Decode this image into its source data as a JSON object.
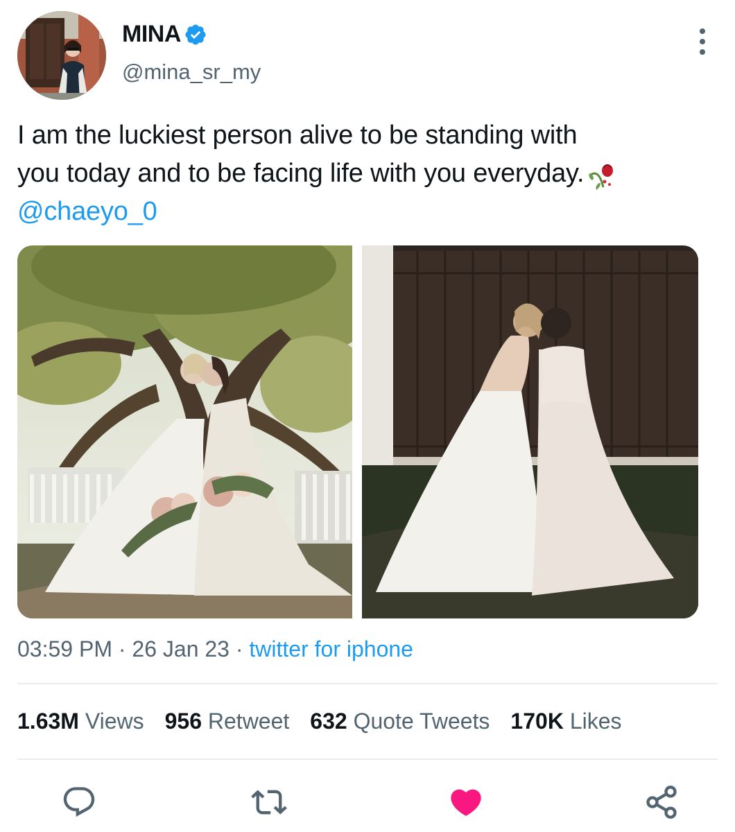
{
  "user": {
    "name": "MINA",
    "handle": "@mina_sr_my",
    "verified": true,
    "avatar_icon": "profile-photo"
  },
  "tweet": {
    "text_line1": "I am the luckiest person alive to be standing with",
    "text_line2": "you today and to be facing life with you everyday.",
    "emoji_icon": "wilted-rose-emoji",
    "mention": "@chaeyo_0",
    "photos": [
      "wedding-photo-under-tree",
      "wedding-photo-barn-door"
    ]
  },
  "meta": {
    "time": "03:59 PM",
    "separator": " · ",
    "date": "26 Jan 23",
    "source": "twitter for iphone"
  },
  "stats": {
    "views_count": "1.63M",
    "views_label": " Views",
    "retweets_count": "956",
    "retweets_label": " Retweet",
    "quotes_count": "632",
    "quotes_label": " Quote Tweets",
    "likes_count": "170K",
    "likes_label": " Likes"
  },
  "actions": {
    "icons": [
      "reply-icon",
      "retweet-icon",
      "like-icon",
      "share-icon"
    ],
    "like_active": true,
    "like_color": "#f91880",
    "icon_color": "#536471"
  },
  "colors": {
    "accent": "#1d9bf0",
    "text": "#0f1419",
    "secondary": "#536471"
  }
}
